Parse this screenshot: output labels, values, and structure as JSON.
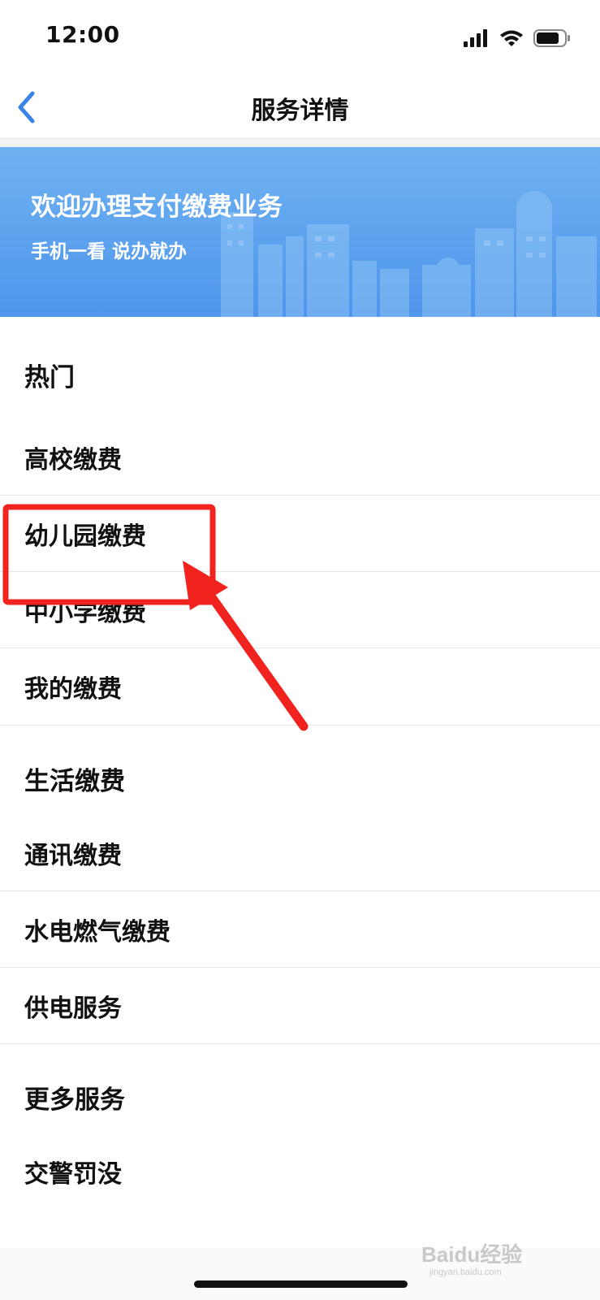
{
  "status_bar": {
    "time": "12:00"
  },
  "nav": {
    "title": "服务详情"
  },
  "banner": {
    "title": "欢迎办理支付缴费业务",
    "subtitle": "手机一看 说办就办"
  },
  "groups": [
    {
      "title": "热门",
      "items": [
        "高校缴费",
        "幼儿园缴费",
        "中小学缴费",
        "我的缴费"
      ]
    },
    {
      "title": "生活缴费",
      "items": [
        "通讯缴费",
        "水电燃气缴费",
        "供电服务"
      ]
    },
    {
      "title": "更多服务",
      "items": [
        "交警罚没"
      ]
    }
  ],
  "watermark": {
    "brand": "Baidu经验",
    "url": "jingyan.baidu.com"
  },
  "colors": {
    "accent": "#3a86e8",
    "annotation": "#f0231f",
    "banner": "#5aa1ee"
  },
  "icons": [
    "back-chevron-icon",
    "signal-icon",
    "wifi-icon",
    "battery-icon"
  ]
}
